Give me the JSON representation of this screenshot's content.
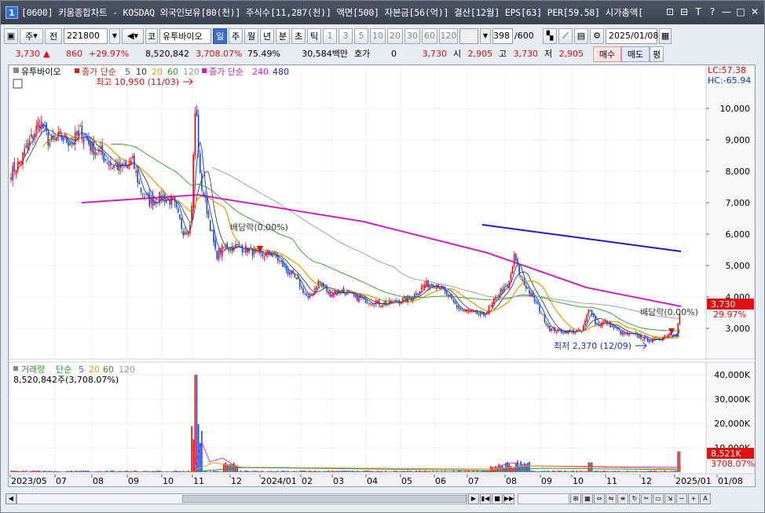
{
  "window": {
    "badge": "1",
    "title": "[0600] 키움종합차트 - KOSDAQ 외국인보유[80(천)] 주식수[11,287(천)] 액면[500] 자본금[56(억)] 결산[12월] EPS[63] PER[59.58] 시가총액[",
    "buttons": [
      "⊡",
      "⊟",
      "T",
      "?",
      "—",
      "□",
      "✕"
    ]
  },
  "toolbar": {
    "market": "주",
    "range": "전",
    "code": "221800",
    "stock_button": "코",
    "stock_name": "유투바이오",
    "periods": [
      "일",
      "주",
      "월",
      "년",
      "분",
      "초",
      "틱"
    ],
    "selected_period": "일",
    "intervals": [
      "1",
      "3",
      "5",
      "10",
      "20",
      "30",
      "60",
      "120"
    ],
    "count": "398",
    "count_total": "/600",
    "date": "2025/01/08"
  },
  "quote": {
    "price": "3,730",
    "change": "860",
    "change_pct": "+29.97%",
    "volume": "8,520,842",
    "volume_ratio": "3,708.07%",
    "turnover": "75.49%",
    "amount": "30,584백만",
    "hoga_label": "호가",
    "hoga_value": "0",
    "current": "3,730",
    "open_label": "시",
    "open": "2,905",
    "high_label": "고",
    "high": "3,730",
    "low_label": "저",
    "low": "2,905",
    "buy_button": "매수",
    "sell_button": "매도",
    "avg_button": "평"
  },
  "price_panel": {
    "stock_label": "유투바이오",
    "legend_main": "종가 단순",
    "ma_short": [
      "5",
      "10",
      "20",
      "60",
      "120"
    ],
    "legend_long": "종가 단순",
    "ma_long": [
      "240",
      "480"
    ],
    "lc": "LC:57.38",
    "hc": "HC:-65.94",
    "high_note": "최고 10,950 (11/03)",
    "low_note": "최저 2,370 (12/09)",
    "dividend_note_1": "배당락(0.00%)",
    "dividend_note_2": "배당락(0.00%)",
    "last_price_tag": "3,730",
    "last_pct_tag": "29.97%",
    "y_ticks": [
      "10,000",
      "9,000",
      "8,000",
      "7,000",
      "6,000",
      "5,000",
      "4,000",
      "3,000"
    ]
  },
  "volume_panel": {
    "legend_label": "거래량",
    "legend_ma": "단순",
    "ma": [
      "5",
      "20",
      "60",
      "120"
    ],
    "current": "8,520,842주(3,708.07%)",
    "last_tag": "8,521K",
    "last_pct_tag": "3708.07%",
    "y_ticks": [
      "40,000K",
      "30,000K",
      "20,000K",
      "10,000K"
    ]
  },
  "x_axis": [
    "2023/05",
    "07",
    "08",
    "09",
    "10",
    "11",
    "12",
    "2024/01",
    "02",
    "03",
    "04",
    "05",
    "06",
    "07",
    "08",
    "09",
    "10",
    "11",
    "12",
    "2025/01",
    "01/08"
  ],
  "colors": {
    "up": "#e01010",
    "down": "#1446d8",
    "ma5": "#2f5fe0",
    "ma10": "#2d2d2d",
    "ma20": "#f0a000",
    "ma60": "#2a9a2a",
    "ma120": "#999999",
    "ma240": "#d020c0",
    "ma480": "#1a1ad0"
  },
  "chart_data": {
    "type": "candlestick",
    "ylim": [
      2000,
      11500
    ],
    "series": [
      {
        "name": "240",
        "x": [
          "2023/07/10",
          "2023/11/01",
          "2024/04/01",
          "2024/07/20",
          "2024/10/15",
          "2025/01/08"
        ],
        "values": [
          7000,
          7250,
          6400,
          5400,
          4300,
          3700
        ]
      },
      {
        "name": "480",
        "x": [
          "2024/07/15",
          "2025/01/08"
        ],
        "values": [
          6300,
          5450
        ]
      }
    ],
    "annotations": [
      {
        "text": "최고 10,950 (11/03)",
        "x": "2023/11/03",
        "y": 10950
      },
      {
        "text": "최저 2,370 (12/09)",
        "x": "2024/12/09",
        "y": 2370
      }
    ]
  }
}
